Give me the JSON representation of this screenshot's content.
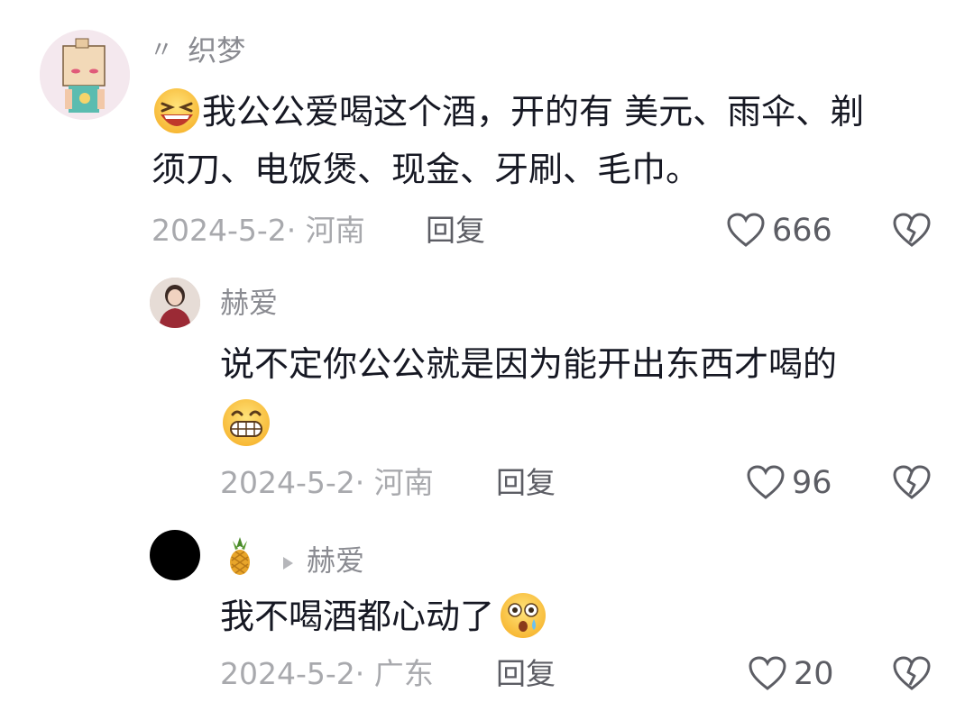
{
  "comments": [
    {
      "user": "织梦",
      "user_prefix": "〃",
      "text_line1": "我公公爱喝这个酒，开的有 美元、雨伞、剃",
      "text_line2": "须刀、电饭煲、现金、牙刷、毛巾。",
      "meta": "2024-5-2· 河南",
      "reply_label": "回复",
      "likes": "666",
      "leading_emoji": "laughing-face-icon"
    },
    {
      "user": "赫爱",
      "text_line1": "说不定你公公就是因为能开出东西才喝的",
      "trailing_emoji": "grinning-face-icon",
      "meta": "2024-5-2· 河南",
      "reply_label": "回复",
      "likes": "96"
    },
    {
      "user_emoji": "pineapple-icon",
      "reply_to": "赫爱",
      "text_line1": "我不喝酒都心动了",
      "trailing_emoji": "astonished-face-icon",
      "meta": "2024-5-2· 广东",
      "reply_label": "回复",
      "likes": "20"
    }
  ],
  "colors": {
    "text": "#161823",
    "meta": "#a8a9ad",
    "name": "#8a8b91",
    "reply": "#5c5d64",
    "background": "#ffffff"
  }
}
